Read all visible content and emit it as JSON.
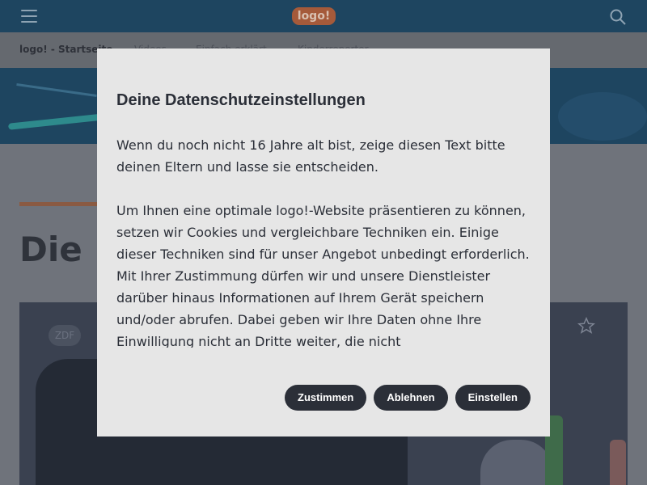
{
  "header": {
    "logo_text": "logo!",
    "menu_icon": "hamburger-icon",
    "search_icon": "search-icon"
  },
  "nav": {
    "items": [
      "logo! - Startseite",
      "Videos",
      "Einfach erklärt",
      "Kinderreporter"
    ]
  },
  "page": {
    "headline": "Die U",
    "media_badge": "ZDF",
    "favorite_icon": "star-icon"
  },
  "modal": {
    "title": "Deine Datenschutzeinstellungen",
    "paragraph_1": "Wenn du noch nicht 16 Jahre alt bist, zeige diesen Text bitte deinen Eltern und lasse sie entscheiden.",
    "paragraph_2": "Um Ihnen eine optimale logo!-Website präsentieren zu können, setzen wir Cookies und vergleichbare Techniken ein. Einige dieser Techniken sind für unser Angebot unbedingt erforderlich. Mit Ihrer Zustimmung dürfen wir und unsere Dienstleister darüber hinaus Informationen auf Ihrem Gerät speichern und/oder abrufen. Dabei geben wir Ihre Daten ohne Ihre Einwilligung nicht an Dritte weiter, die nicht",
    "buttons": {
      "accept": "Zustimmen",
      "reject": "Ablehnen",
      "settings": "Einstellen"
    }
  },
  "colors": {
    "button_bg": "#2b2f38",
    "modal_bg": "#e6e6e6",
    "header_bg": "#1e4560"
  }
}
